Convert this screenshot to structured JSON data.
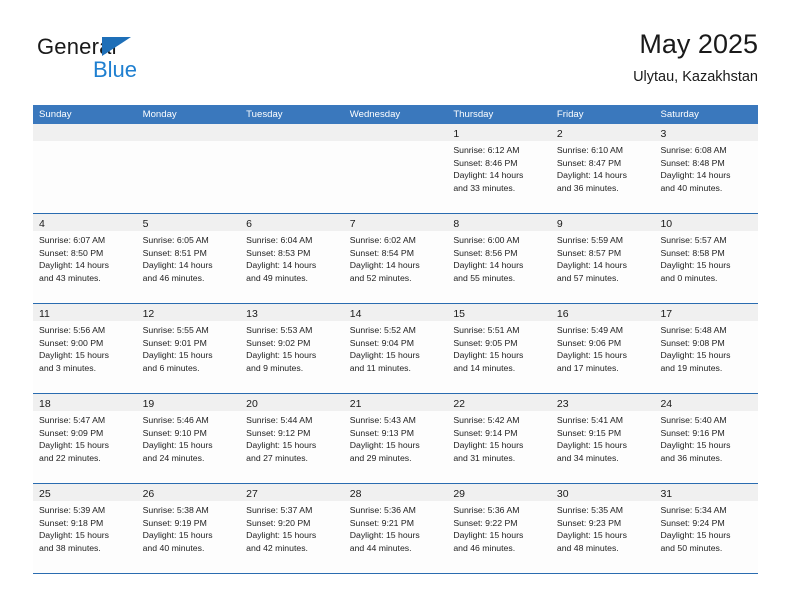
{
  "brand": {
    "name_part1": "General",
    "name_part2": "Blue",
    "triangle_color": "#1e6fb8",
    "blue_text_color": "#1e7fd0"
  },
  "header": {
    "title": "May 2025",
    "subtitle": "Ulytau, Kazakhstan"
  },
  "theme": {
    "header_bar_color": "#3a78bd",
    "row_divider_color": "#2a6cb0",
    "day_band_color": "#f0f0f0",
    "cell_background": "#fdfdfd"
  },
  "weekdays": [
    "Sunday",
    "Monday",
    "Tuesday",
    "Wednesday",
    "Thursday",
    "Friday",
    "Saturday"
  ],
  "weeks": [
    [
      {
        "day": "",
        "sunrise": "",
        "sunset": "",
        "daylight_line1": "",
        "daylight_line2": ""
      },
      {
        "day": "",
        "sunrise": "",
        "sunset": "",
        "daylight_line1": "",
        "daylight_line2": ""
      },
      {
        "day": "",
        "sunrise": "",
        "sunset": "",
        "daylight_line1": "",
        "daylight_line2": ""
      },
      {
        "day": "",
        "sunrise": "",
        "sunset": "",
        "daylight_line1": "",
        "daylight_line2": ""
      },
      {
        "day": "1",
        "sunrise": "Sunrise: 6:12 AM",
        "sunset": "Sunset: 8:46 PM",
        "daylight_line1": "Daylight: 14 hours",
        "daylight_line2": "and 33 minutes."
      },
      {
        "day": "2",
        "sunrise": "Sunrise: 6:10 AM",
        "sunset": "Sunset: 8:47 PM",
        "daylight_line1": "Daylight: 14 hours",
        "daylight_line2": "and 36 minutes."
      },
      {
        "day": "3",
        "sunrise": "Sunrise: 6:08 AM",
        "sunset": "Sunset: 8:48 PM",
        "daylight_line1": "Daylight: 14 hours",
        "daylight_line2": "and 40 minutes."
      }
    ],
    [
      {
        "day": "4",
        "sunrise": "Sunrise: 6:07 AM",
        "sunset": "Sunset: 8:50 PM",
        "daylight_line1": "Daylight: 14 hours",
        "daylight_line2": "and 43 minutes."
      },
      {
        "day": "5",
        "sunrise": "Sunrise: 6:05 AM",
        "sunset": "Sunset: 8:51 PM",
        "daylight_line1": "Daylight: 14 hours",
        "daylight_line2": "and 46 minutes."
      },
      {
        "day": "6",
        "sunrise": "Sunrise: 6:04 AM",
        "sunset": "Sunset: 8:53 PM",
        "daylight_line1": "Daylight: 14 hours",
        "daylight_line2": "and 49 minutes."
      },
      {
        "day": "7",
        "sunrise": "Sunrise: 6:02 AM",
        "sunset": "Sunset: 8:54 PM",
        "daylight_line1": "Daylight: 14 hours",
        "daylight_line2": "and 52 minutes."
      },
      {
        "day": "8",
        "sunrise": "Sunrise: 6:00 AM",
        "sunset": "Sunset: 8:56 PM",
        "daylight_line1": "Daylight: 14 hours",
        "daylight_line2": "and 55 minutes."
      },
      {
        "day": "9",
        "sunrise": "Sunrise: 5:59 AM",
        "sunset": "Sunset: 8:57 PM",
        "daylight_line1": "Daylight: 14 hours",
        "daylight_line2": "and 57 minutes."
      },
      {
        "day": "10",
        "sunrise": "Sunrise: 5:57 AM",
        "sunset": "Sunset: 8:58 PM",
        "daylight_line1": "Daylight: 15 hours",
        "daylight_line2": "and 0 minutes."
      }
    ],
    [
      {
        "day": "11",
        "sunrise": "Sunrise: 5:56 AM",
        "sunset": "Sunset: 9:00 PM",
        "daylight_line1": "Daylight: 15 hours",
        "daylight_line2": "and 3 minutes."
      },
      {
        "day": "12",
        "sunrise": "Sunrise: 5:55 AM",
        "sunset": "Sunset: 9:01 PM",
        "daylight_line1": "Daylight: 15 hours",
        "daylight_line2": "and 6 minutes."
      },
      {
        "day": "13",
        "sunrise": "Sunrise: 5:53 AM",
        "sunset": "Sunset: 9:02 PM",
        "daylight_line1": "Daylight: 15 hours",
        "daylight_line2": "and 9 minutes."
      },
      {
        "day": "14",
        "sunrise": "Sunrise: 5:52 AM",
        "sunset": "Sunset: 9:04 PM",
        "daylight_line1": "Daylight: 15 hours",
        "daylight_line2": "and 11 minutes."
      },
      {
        "day": "15",
        "sunrise": "Sunrise: 5:51 AM",
        "sunset": "Sunset: 9:05 PM",
        "daylight_line1": "Daylight: 15 hours",
        "daylight_line2": "and 14 minutes."
      },
      {
        "day": "16",
        "sunrise": "Sunrise: 5:49 AM",
        "sunset": "Sunset: 9:06 PM",
        "daylight_line1": "Daylight: 15 hours",
        "daylight_line2": "and 17 minutes."
      },
      {
        "day": "17",
        "sunrise": "Sunrise: 5:48 AM",
        "sunset": "Sunset: 9:08 PM",
        "daylight_line1": "Daylight: 15 hours",
        "daylight_line2": "and 19 minutes."
      }
    ],
    [
      {
        "day": "18",
        "sunrise": "Sunrise: 5:47 AM",
        "sunset": "Sunset: 9:09 PM",
        "daylight_line1": "Daylight: 15 hours",
        "daylight_line2": "and 22 minutes."
      },
      {
        "day": "19",
        "sunrise": "Sunrise: 5:46 AM",
        "sunset": "Sunset: 9:10 PM",
        "daylight_line1": "Daylight: 15 hours",
        "daylight_line2": "and 24 minutes."
      },
      {
        "day": "20",
        "sunrise": "Sunrise: 5:44 AM",
        "sunset": "Sunset: 9:12 PM",
        "daylight_line1": "Daylight: 15 hours",
        "daylight_line2": "and 27 minutes."
      },
      {
        "day": "21",
        "sunrise": "Sunrise: 5:43 AM",
        "sunset": "Sunset: 9:13 PM",
        "daylight_line1": "Daylight: 15 hours",
        "daylight_line2": "and 29 minutes."
      },
      {
        "day": "22",
        "sunrise": "Sunrise: 5:42 AM",
        "sunset": "Sunset: 9:14 PM",
        "daylight_line1": "Daylight: 15 hours",
        "daylight_line2": "and 31 minutes."
      },
      {
        "day": "23",
        "sunrise": "Sunrise: 5:41 AM",
        "sunset": "Sunset: 9:15 PM",
        "daylight_line1": "Daylight: 15 hours",
        "daylight_line2": "and 34 minutes."
      },
      {
        "day": "24",
        "sunrise": "Sunrise: 5:40 AM",
        "sunset": "Sunset: 9:16 PM",
        "daylight_line1": "Daylight: 15 hours",
        "daylight_line2": "and 36 minutes."
      }
    ],
    [
      {
        "day": "25",
        "sunrise": "Sunrise: 5:39 AM",
        "sunset": "Sunset: 9:18 PM",
        "daylight_line1": "Daylight: 15 hours",
        "daylight_line2": "and 38 minutes."
      },
      {
        "day": "26",
        "sunrise": "Sunrise: 5:38 AM",
        "sunset": "Sunset: 9:19 PM",
        "daylight_line1": "Daylight: 15 hours",
        "daylight_line2": "and 40 minutes."
      },
      {
        "day": "27",
        "sunrise": "Sunrise: 5:37 AM",
        "sunset": "Sunset: 9:20 PM",
        "daylight_line1": "Daylight: 15 hours",
        "daylight_line2": "and 42 minutes."
      },
      {
        "day": "28",
        "sunrise": "Sunrise: 5:36 AM",
        "sunset": "Sunset: 9:21 PM",
        "daylight_line1": "Daylight: 15 hours",
        "daylight_line2": "and 44 minutes."
      },
      {
        "day": "29",
        "sunrise": "Sunrise: 5:36 AM",
        "sunset": "Sunset: 9:22 PM",
        "daylight_line1": "Daylight: 15 hours",
        "daylight_line2": "and 46 minutes."
      },
      {
        "day": "30",
        "sunrise": "Sunrise: 5:35 AM",
        "sunset": "Sunset: 9:23 PM",
        "daylight_line1": "Daylight: 15 hours",
        "daylight_line2": "and 48 minutes."
      },
      {
        "day": "31",
        "sunrise": "Sunrise: 5:34 AM",
        "sunset": "Sunset: 9:24 PM",
        "daylight_line1": "Daylight: 15 hours",
        "daylight_line2": "and 50 minutes."
      }
    ]
  ]
}
